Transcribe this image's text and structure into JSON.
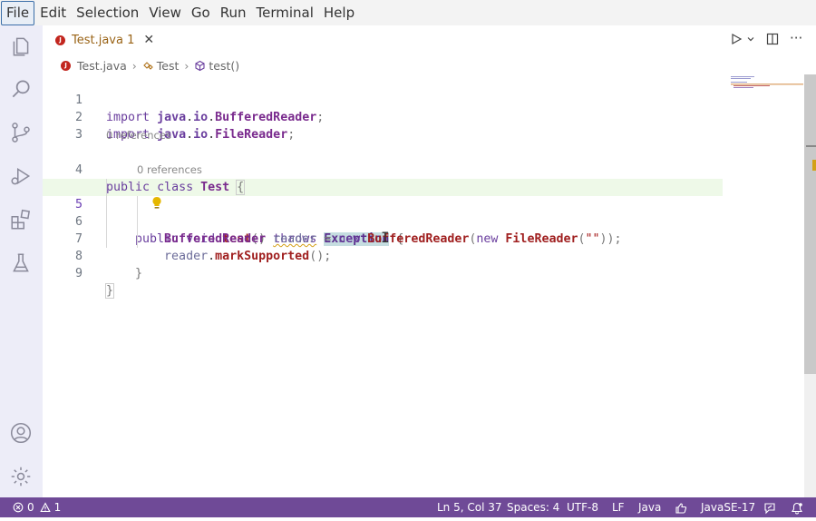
{
  "menu": [
    "File",
    "Edit",
    "Selection",
    "View",
    "Go",
    "Run",
    "Terminal",
    "Help"
  ],
  "tab": {
    "title": "Test.java 1",
    "icon": "java-icon",
    "badge": "J"
  },
  "breadcrumb": {
    "file": "Test.java",
    "class": "Test",
    "method": "test()"
  },
  "code_lines": [
    {
      "num": "1",
      "text": "import java.io.BufferedReader;"
    },
    {
      "num": "2",
      "text": "import java.io.FileReader;"
    },
    {
      "num": "3",
      "text": ""
    },
    {
      "num": "4",
      "text": "public class Test {"
    },
    {
      "num": "5",
      "text": "    public void test() throws Exception {"
    },
    {
      "num": "6",
      "text": "        BufferedReader reader = new BufferedReader(new FileReader(\"\"));"
    },
    {
      "num": "7",
      "text": "        reader.markSupported();"
    },
    {
      "num": "8",
      "text": "    }"
    },
    {
      "num": "9",
      "text": "}"
    }
  ],
  "codelens": {
    "class_refs": "0 references",
    "method_refs": "0 references"
  },
  "status": {
    "errors": "0",
    "warnings": "1",
    "position": "Ln 5, Col 37",
    "spaces": "Spaces: 4",
    "encoding": "UTF-8",
    "eol": "LF",
    "language": "Java",
    "runtime": "JavaSE-17"
  },
  "colors": {
    "status_bar": "#6f4a97",
    "activity_bar": "#ededf8",
    "current_line": "#eef9e8"
  }
}
